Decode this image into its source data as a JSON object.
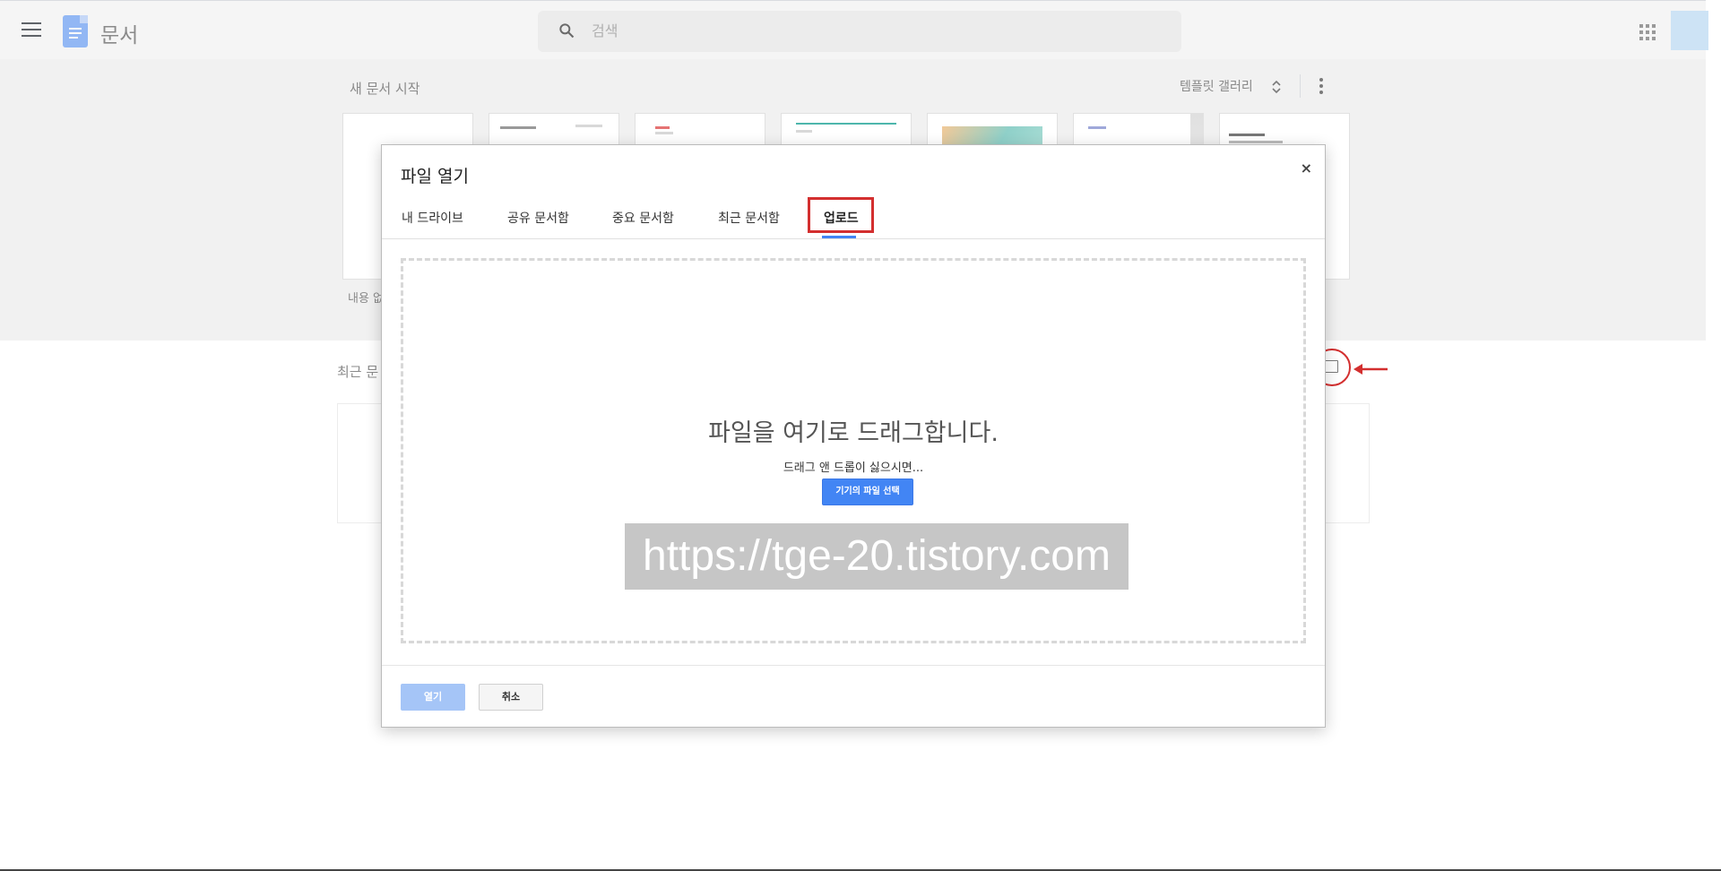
{
  "header": {
    "app_title": "문서",
    "search_placeholder": "검색"
  },
  "templates": {
    "section_title": "새 문서 시작",
    "gallery_label": "템플릿 갤러리",
    "blank_label": "내용 없",
    "thumbnails": [
      "blank",
      "resume",
      "letter",
      "project-proposal",
      "brochure",
      "newsletter",
      "report"
    ]
  },
  "recent": {
    "section_label": "최근 문"
  },
  "dialog": {
    "title": "파일 열기",
    "close_label": "×",
    "tabs": [
      {
        "label": "내 드라이브"
      },
      {
        "label": "공유 문서함"
      },
      {
        "label": "중요 문서함"
      },
      {
        "label": "최근 문서함"
      },
      {
        "label": "업로드",
        "active": true
      }
    ],
    "drop_title": "파일을 여기로 드래그합니다.",
    "drop_subtitle": "드래그 앤 드롭이 싫으시면...",
    "select_button": "기기의 파일 선택",
    "watermark": "https://tge-20.tistory.com",
    "open_button": "열기",
    "cancel_button": "취소"
  },
  "colors": {
    "accent": "#4285f4",
    "highlight": "#d32f2f"
  }
}
